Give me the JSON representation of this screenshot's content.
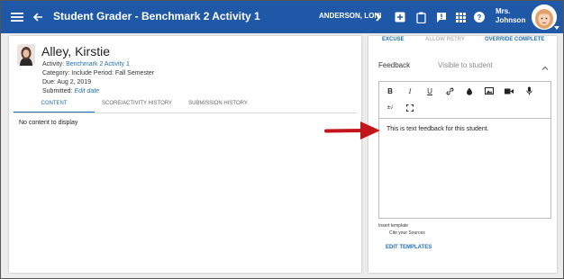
{
  "header": {
    "title": "Student Grader - Benchmark 2 Activity 1",
    "student": "ANDERSON, LONI",
    "user_line1": "Mrs.",
    "user_line2": "Johnson",
    "accent": "#1f58a7",
    "icons": [
      "menu-icon",
      "back-arrow-icon",
      "next-chevron-icon",
      "add-box-icon",
      "clipboard-icon",
      "feedback-icon",
      "apps-grid-icon",
      "help-icon"
    ]
  },
  "student": {
    "name": "Alley, Kirstie",
    "activity_label": "Activity:",
    "activity_link": "Benchmark 2 Activity 1",
    "category_line": "Category: Include   Period: Fall Semester",
    "due_line": "Due: Aug 2, 2019",
    "submitted_label": "Submitted:",
    "submitted_link": "Edit date"
  },
  "tabs": [
    "CONTENT",
    "SCORE/ACTIVITY HISTORY",
    "SUBMISSION HISTORY"
  ],
  "content": {
    "empty": "No content to display"
  },
  "actions": {
    "excuse": "EXCUSE",
    "allow_retry": "ALLOW RETRY",
    "override": "OVERRIDE COMPLETE"
  },
  "feedback": {
    "label": "Feedback",
    "visibility": "Visible to student",
    "text": "This is text feedback for this student.",
    "toolbar": [
      "B",
      "I",
      "U",
      "link-icon",
      "color-drop-icon",
      "image-icon",
      "video-icon",
      "mic-icon",
      "math-icon",
      "fullscreen-icon"
    ],
    "insert_template": "Insert template",
    "template_item": "Cite your Sources",
    "edit_templates": "EDIT TEMPLATES"
  },
  "colors": {
    "link": "#1f6fb5",
    "annotation_arrow": "#c3161c"
  }
}
